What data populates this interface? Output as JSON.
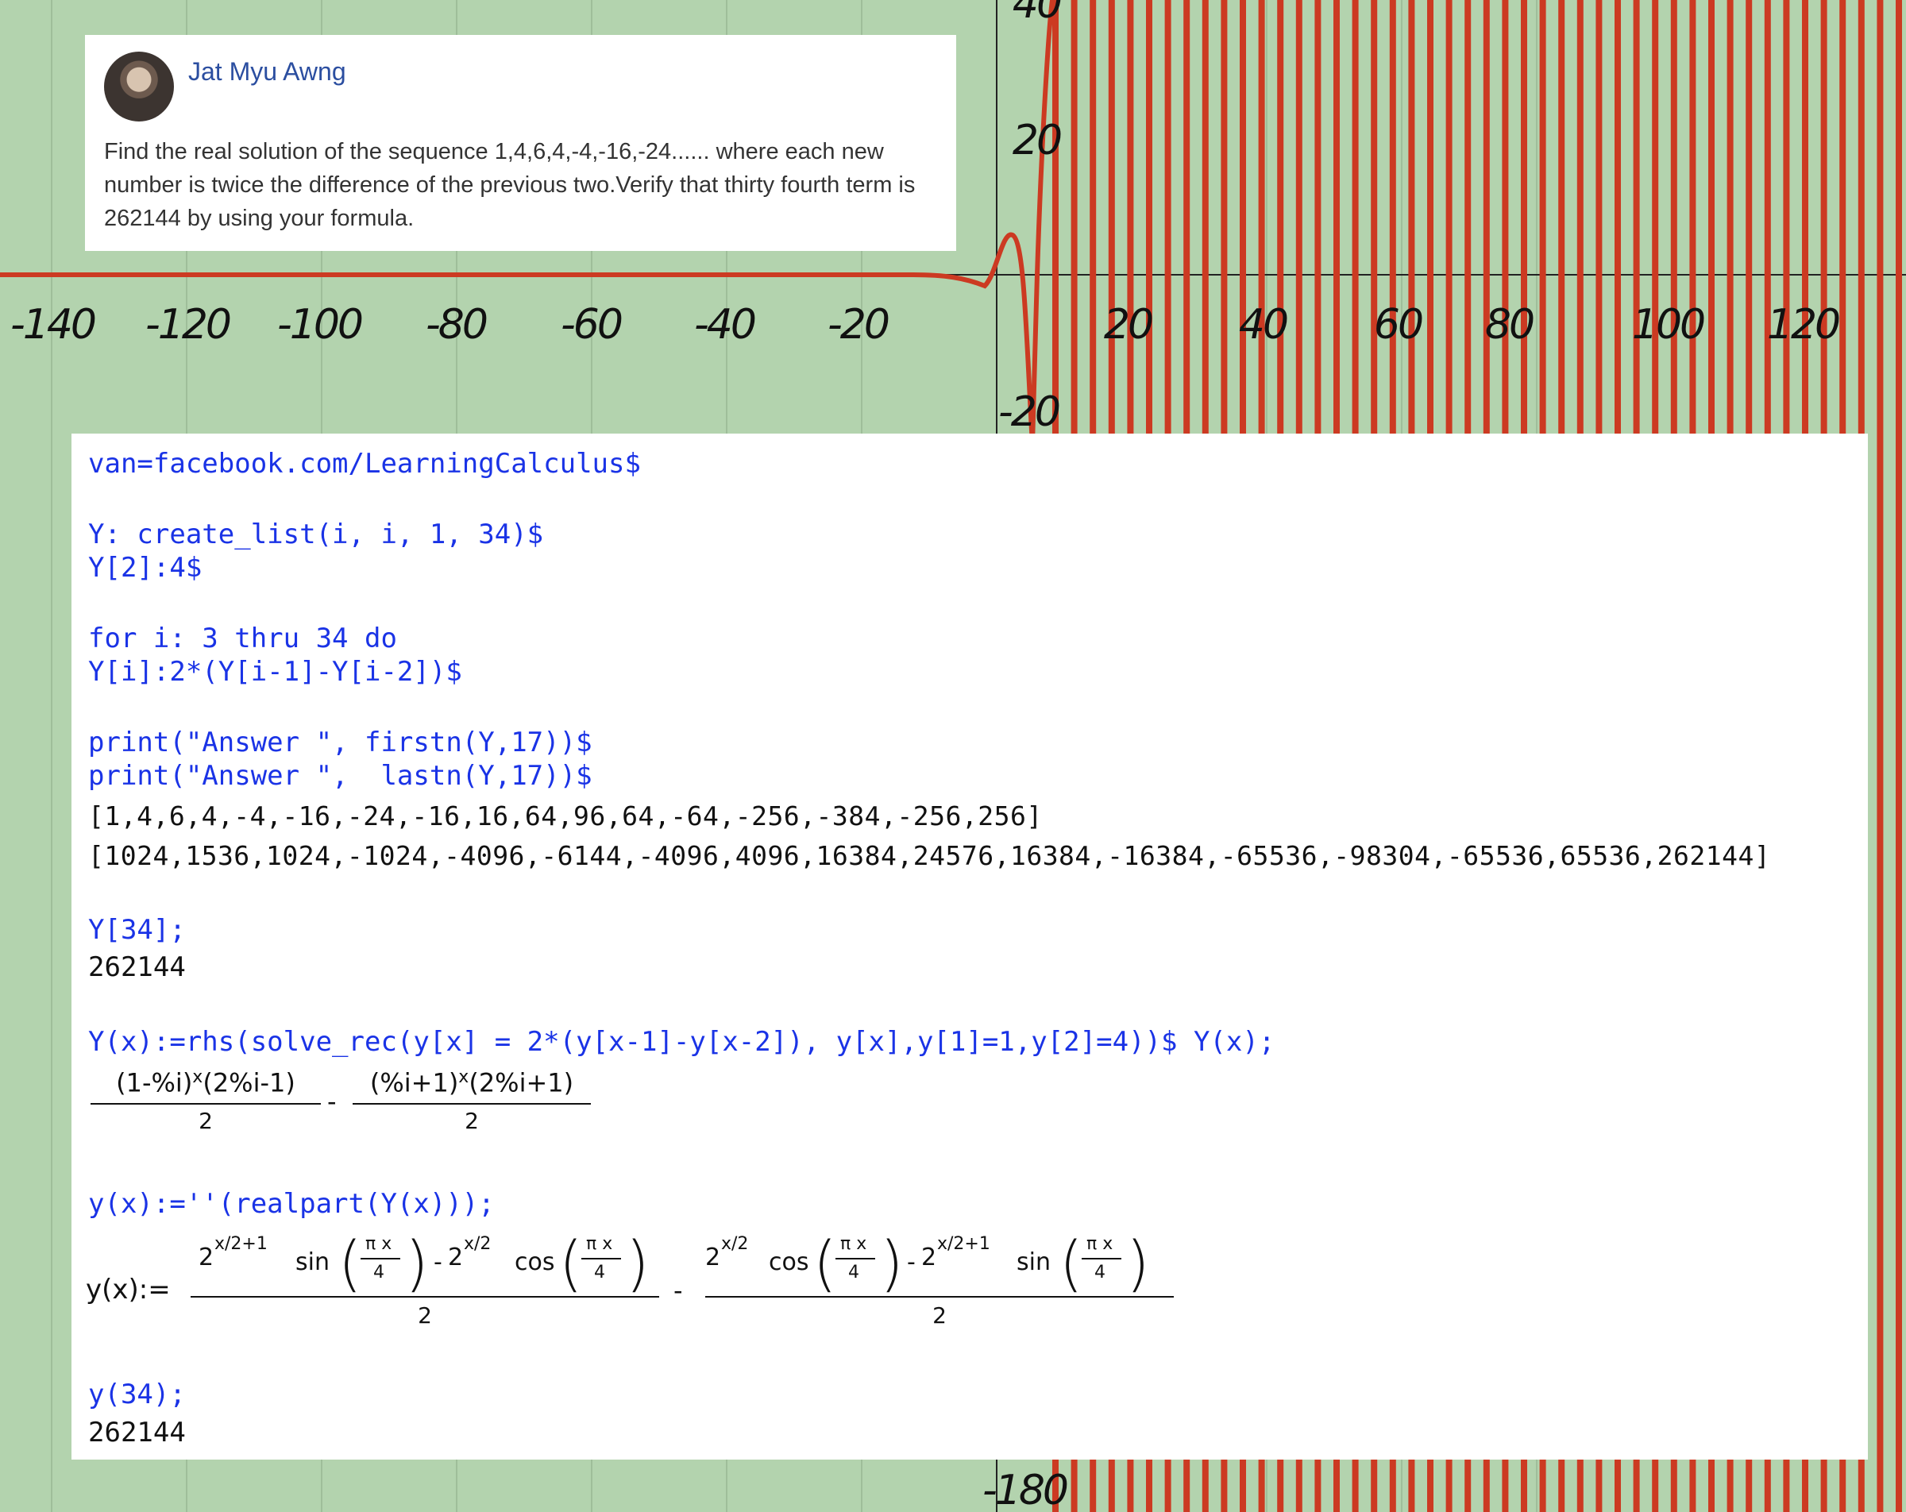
{
  "post": {
    "author": "Jat Myu Awng",
    "text": "Find the real solution of the sequence 1,4,6,4,-4,-16,-24...... where each new number is twice the difference of the previous two.Verify that thirty fourth term is 262144 by using your formula."
  },
  "graph": {
    "x_ticks": [
      "-140",
      "-120",
      "-100",
      "-80",
      "-60",
      "-40",
      "-20",
      "20",
      "40",
      "60",
      "80",
      "100",
      "120"
    ],
    "y_ticks": [
      "40",
      "20",
      "-20",
      "-180"
    ],
    "colors": {
      "background": "#b3d3ae",
      "curve": "#cc3a22",
      "axis": "#222222"
    }
  },
  "maxima": {
    "line1": "van=facebook.com/LearningCalculus$",
    "line2": "Y: create_list(i, i, 1, 34)$",
    "line3": "Y[2]:4$",
    "line4": "for i: 3 thru 34 do",
    "line5": "Y[i]:2*(Y[i-1]-Y[i-2])$",
    "line6": "print(\"Answer \", firstn(Y,17))$",
    "line7": "print(\"Answer \",  lastn(Y,17))$",
    "out1": "[1,4,6,4,-4,-16,-24,-16,16,64,96,64,-64,-256,-384,-256,256]",
    "out2": "[1024,1536,1024,-1024,-4096,-6144,-4096,4096,16384,24576,16384,-16384,-65536,-98304,-65536,65536,262144]",
    "line8": "Y[34];",
    "out3": "262144",
    "line9": "Y(x):=rhs(solve_rec(y[x] = 2*(y[x-1]-y[x-2]), y[x],y[1]=1,y[2]=4))$ Y(x);",
    "expr1": {
      "num1": "(1-%i)",
      "num1_tail": "(2%i-1)",
      "num2": "(%i+1)",
      "num2_tail": "(2%i+1)",
      "exponent": "x",
      "den": "2",
      "minus": "-"
    },
    "line10": "y(x):=''(realpart(Y(x)));",
    "expr2": {
      "lhs": "y(x):=",
      "pow1": "x/2+1",
      "pow2": "x/2",
      "base": "2",
      "sin": "sin",
      "cos": "cos",
      "arg_num": "π x",
      "arg_den": "4",
      "den": "2",
      "minus": "-"
    },
    "line11": "y(34);",
    "out4": "262144"
  }
}
